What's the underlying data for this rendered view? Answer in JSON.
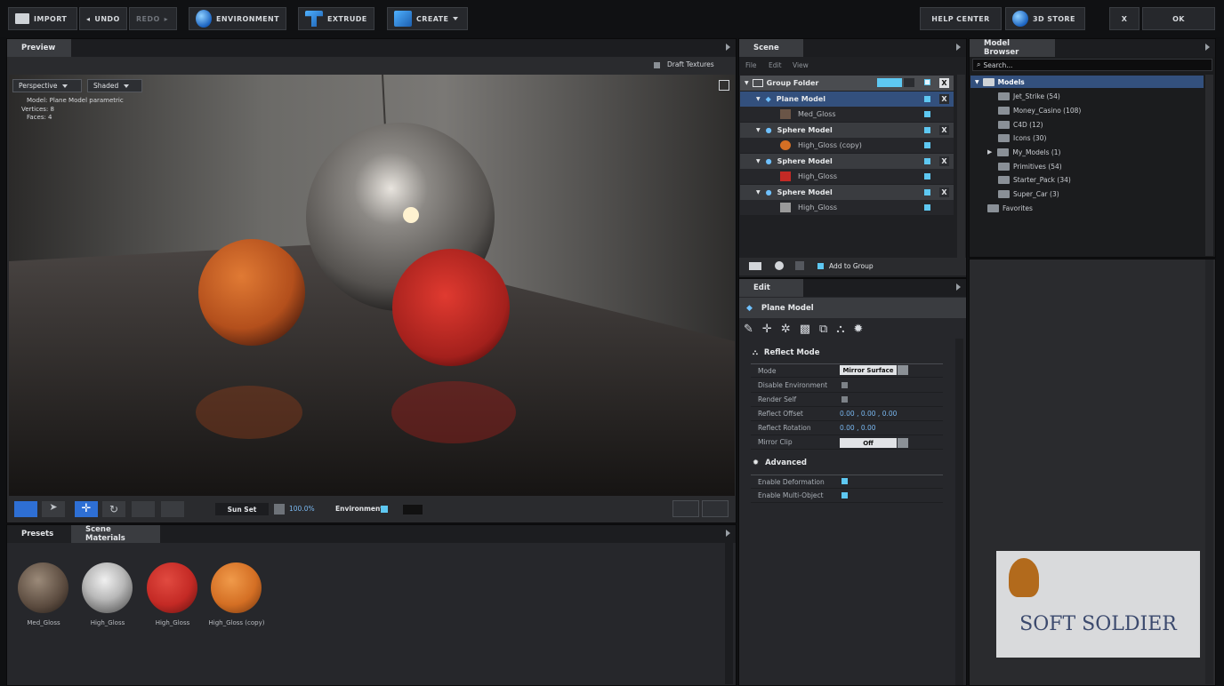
{
  "toolbar": {
    "import": "IMPORT",
    "undo": "UNDO",
    "redo": "REDO",
    "environment": "ENVIRONMENT",
    "extrude": "EXTRUDE",
    "create": "CREATE",
    "help_center": "HELP CENTER",
    "store": "3D STORE",
    "close": "X",
    "ok": "OK"
  },
  "preview": {
    "tab": "Preview",
    "draft_textures": "Draft Textures",
    "camera": "Perspective",
    "shading": "Shaded",
    "info_model": "Model: Plane Model parametric",
    "info_vertices": "Vertices: 8",
    "info_faces": "Faces: 4",
    "lighting_preset": "Sun Set",
    "zoom": "100.0%",
    "environment_label": "Environment"
  },
  "bottom": {
    "tabs": [
      "Presets",
      "Scene Materials"
    ],
    "materials": [
      {
        "label": "Med_Gloss",
        "color": "#5a4a3e"
      },
      {
        "label": "High_Gloss",
        "color": "#b8b8b8"
      },
      {
        "label": "High_Gloss",
        "color": "#c42a25"
      },
      {
        "label": "High_Gloss (copy)",
        "color": "#d46f24"
      }
    ]
  },
  "scene": {
    "tab": "Scene",
    "menu": [
      "File",
      "Edit",
      "View"
    ],
    "group_folder": "Group Folder",
    "items": [
      {
        "name": "Plane Model",
        "material": "Med_Gloss"
      },
      {
        "name": "Sphere Model",
        "material": "High_Gloss (copy)"
      },
      {
        "name": "Sphere Model",
        "material": "High_Gloss"
      },
      {
        "name": "Sphere Model",
        "material": "High_Gloss"
      }
    ],
    "add_to_group": "Add to Group"
  },
  "edit": {
    "tab": "Edit",
    "title": "Plane Model",
    "section_reflect": "Reflect Mode",
    "rows": {
      "mode": "Mode",
      "mode_value": "Mirror Surface",
      "disable_env": "Disable Environment",
      "render_self": "Render Self",
      "reflect_offset": "Reflect Offset",
      "reflect_offset_value": "0.00 ,  0.00 ,  0.00",
      "reflect_rotation": "Reflect Rotation",
      "reflect_rotation_value": "0.00 ,  0.00",
      "mirror_clip": "Mirror Clip",
      "mirror_clip_value": "Off"
    },
    "section_advanced": "Advanced",
    "enable_deformation": "Enable Deformation",
    "enable_multi_object": "Enable Multi-Object"
  },
  "browser": {
    "tab": "Model Browser",
    "search_placeholder": "Search...",
    "root": "Models",
    "items": [
      "Jet_Strike (54)",
      "Money_Casino (108)",
      "C4D (12)",
      "Icons (30)",
      "My_Models (1)",
      "Primitives (54)",
      "Starter_Pack (34)",
      "Super_Car (3)"
    ],
    "favorites": "Favorites"
  },
  "watermark": "SOFT SOLDIER"
}
